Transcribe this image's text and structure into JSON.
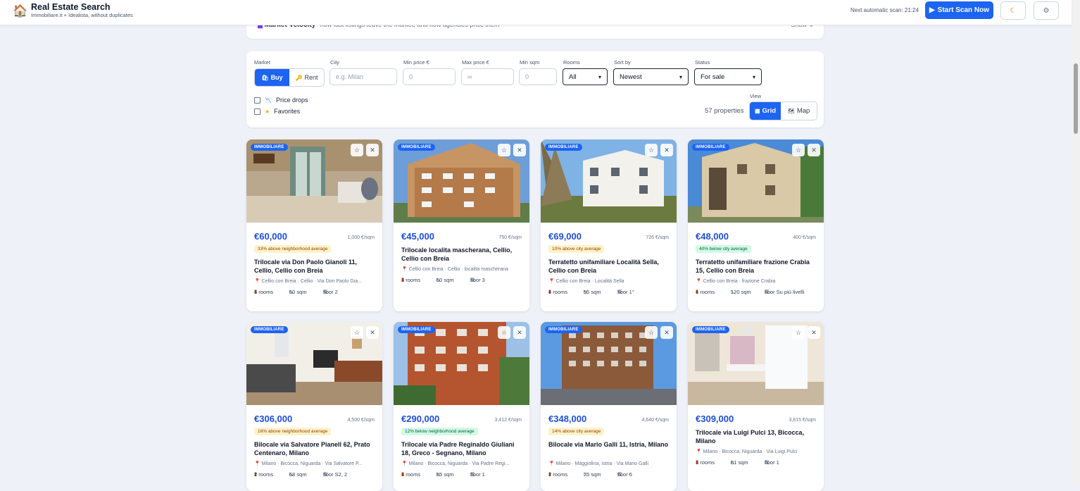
{
  "header": {
    "title": "Real Estate Search",
    "subtitle": "Immobiliare.it + Idealista, without duplicates",
    "next_scan": "Next automatic scan: 21:24",
    "scan_button": "Start Scan Now"
  },
  "velocity": {
    "title": "Market Velocity",
    "description": "how fast listings leave the market, and how agencies price them",
    "toggle": "Show"
  },
  "filters": {
    "market_label": "Market",
    "buy": "Buy",
    "rent": "Rent",
    "city_label": "City",
    "city_placeholder": "e.g. Milan",
    "min_price_label": "Min price €",
    "min_price_placeholder": "0",
    "max_price_label": "Max price €",
    "max_price_placeholder": "∞",
    "min_sqm_label": "Min sqm",
    "min_sqm_placeholder": "0",
    "rooms_label": "Rooms",
    "rooms_value": "All",
    "sort_label": "Sort by",
    "sort_value": "Newest",
    "status_label": "Status",
    "status_value": "For sale",
    "price_drops": "Price drops",
    "favorites": "Favorites",
    "count": "57 properties",
    "view_label": "View",
    "grid": "Grid",
    "map": "Map"
  },
  "listings": [
    {
      "source": "IMMOBILIARE",
      "price": "€60,000",
      "sqm_price": "1,000 €/sqm",
      "tag": "33% above neighborhood average",
      "tag_type": "above",
      "title": "Trilocale via Don Paolo Gianoli 11, Cellio, Cellio con Breia",
      "location": "Cellio con Breia · Cellio · Via Don Paolo Gia...",
      "rooms": "3 rooms",
      "size": "60 sqm",
      "floor": "floor 2"
    },
    {
      "source": "IMMOBILIARE",
      "price": "€45,000",
      "sqm_price": "750 €/sqm",
      "tag": "",
      "tag_type": "",
      "title": "Trilocale localita mascherana, Cellio, Cellio con Breia",
      "location": "Cellio con Breia · Cellio · localita mascherana",
      "rooms": "3 rooms",
      "size": "60 sqm",
      "floor": "floor 3"
    },
    {
      "source": "IMMOBILIARE",
      "price": "€69,000",
      "sqm_price": "726 €/sqm",
      "tag": "10% above city average",
      "tag_type": "above",
      "title": "Terratetto unifamiliare Località Sella, Cellio con Breia",
      "location": "Cellio con Breia · Località Sella",
      "rooms": "4 rooms",
      "size": "95 sqm",
      "floor": "floor 1°"
    },
    {
      "source": "IMMOBILIARE",
      "price": "€48,000",
      "sqm_price": "400 €/sqm",
      "tag": "40% below city average",
      "tag_type": "below",
      "title": "Terratetto unifamiliare frazione Crabia 15, Cellio con Breia",
      "location": "Cellio con Breia · frazione Crabia",
      "rooms": "4 rooms",
      "size": "120 sqm",
      "floor": "floor Su più livelli"
    },
    {
      "source": "IMMOBILIARE",
      "price": "€306,000",
      "sqm_price": "4,500 €/sqm",
      "tag": "16% above neighborhood average",
      "tag_type": "above",
      "title": "Bilocale via Salvatore Pianell 62, Prato Centenaro, Milano",
      "location": "Milano · Bicocca, Niguarda · Via Salvatore P...",
      "rooms": "2 rooms",
      "size": "68 sqm",
      "floor": "floor S2, 2"
    },
    {
      "source": "IMMOBILIARE",
      "price": "€290,000",
      "sqm_price": "3,412 €/sqm",
      "tag": "12% below neighborhood average",
      "tag_type": "below",
      "title": "Trilocale via Padre Reginaldo Giuliani 18, Greco - Segnano, Milano",
      "location": "Milano · Bicocca, Niguarda · Via Padre Regi...",
      "rooms": "3 rooms",
      "size": "85 sqm",
      "floor": "floor 1"
    },
    {
      "source": "IMMOBILIARE",
      "price": "€348,000",
      "sqm_price": "4,640 €/sqm",
      "tag": "14% above city average",
      "tag_type": "above",
      "title": "Bilocale via Mario Galli 11, Istria, Milano",
      "location": "Milano · Maggiolina, Istria · Via Mario Galli",
      "rooms": "2 rooms",
      "size": "75 sqm",
      "floor": "floor 6"
    },
    {
      "source": "IMMOBILIARE",
      "price": "€309,000",
      "sqm_price": "3,815 €/sqm",
      "tag": "",
      "tag_type": "",
      "title": "Trilocale via Luigi Pulci 13, Bicocca, Milano",
      "location": "Milano · Bicocca, Niguarda · Via Luigi Pulci",
      "rooms": "3 rooms",
      "size": "81 sqm",
      "floor": "floor 1"
    }
  ],
  "colors": {
    "accent": "#1d64f2",
    "price": "#1d4ed8",
    "above_bg": "#fef3c7",
    "below_bg": "#d1fae5"
  },
  "icons": {
    "logo": "house-icon",
    "scan": "play-icon",
    "theme": "moon-icon",
    "settings": "gear-icon",
    "favorite": "star-icon",
    "hide": "close-icon",
    "location": "pin-icon",
    "rooms": "door-icon",
    "size": "ruler-icon",
    "floor": "building-icon"
  }
}
